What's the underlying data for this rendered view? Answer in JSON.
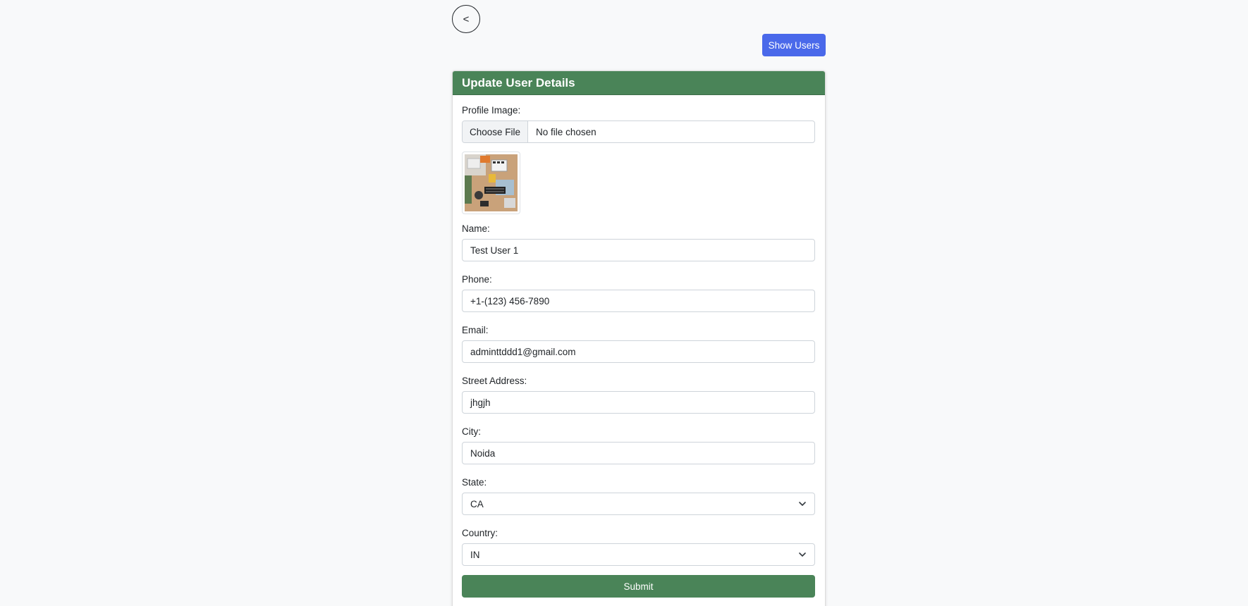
{
  "nav": {
    "back_label": "<",
    "show_users_label": "Show Users"
  },
  "form": {
    "title": "Update User Details",
    "profile_image": {
      "label": "Profile Image:",
      "choose_label": "Choose File",
      "status": "No file chosen"
    },
    "name": {
      "label": "Name:",
      "value": "Test User 1"
    },
    "phone": {
      "label": "Phone:",
      "value": "+1-(123) 456-7890"
    },
    "email": {
      "label": "Email:",
      "value": "adminttddd1@gmail.com"
    },
    "street": {
      "label": "Street Address:",
      "value": "jhgjh"
    },
    "city": {
      "label": "City:",
      "value": "Noida"
    },
    "state": {
      "label": "State:",
      "value": "CA"
    },
    "country": {
      "label": "Country:",
      "value": "IN"
    },
    "submit_label": "Submit"
  },
  "colors": {
    "header_green": "#4a8458",
    "show_users_blue": "#4a69ea",
    "page_bg": "#f8f9fa"
  }
}
